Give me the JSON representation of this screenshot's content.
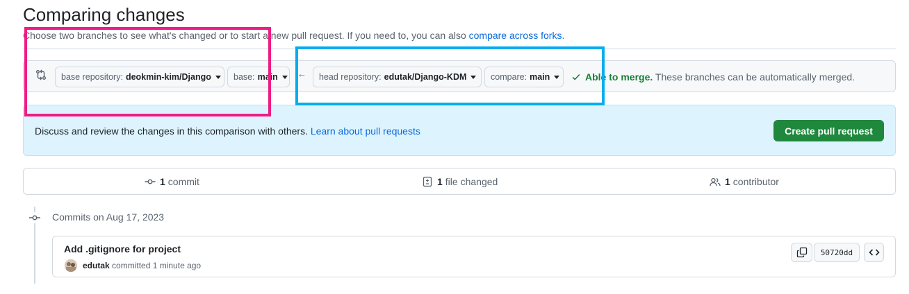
{
  "page": {
    "title": "Comparing changes",
    "subtitle_text": "Choose two branches to see what's changed or to start a new pull request. If you need to, you can also",
    "subtitle_link": "compare across forks."
  },
  "range": {
    "base_repo_label": "base repository:",
    "base_repo_value": "deokmin-kim/Django",
    "base_label": "base:",
    "base_value": "main",
    "head_repo_label": "head repository:",
    "head_repo_value": "edutak/Django-KDM",
    "compare_label": "compare:",
    "compare_value": "main",
    "merge_status": "Able to merge.",
    "merge_note": "These branches can be automatically merged."
  },
  "blankslate": {
    "text": "Discuss and review the changes in this comparison with others.",
    "link": "Learn about pull requests",
    "button": "Create pull request"
  },
  "stats": {
    "commits_count": "1",
    "commits_label": "commit",
    "files_count": "1",
    "files_label": "file changed",
    "contributors_count": "1",
    "contributors_label": "contributor"
  },
  "timeline": {
    "date_heading": "Commits on Aug 17, 2023",
    "commit": {
      "message": "Add .gitignore for project",
      "author": "edutak",
      "meta": "committed 1 minute ago",
      "sha": "50720dd"
    }
  },
  "colors": {
    "annotation_pink": "#ee1c84",
    "annotation_blue": "#00aeef",
    "primary_button": "#1f883d",
    "link": "#0969da"
  },
  "icons": [
    "git-compare-icon",
    "caret-down-icon",
    "arrow-left-icon",
    "check-icon",
    "git-commit-icon",
    "file-diff-icon",
    "people-icon",
    "copy-icon",
    "code-icon"
  ]
}
